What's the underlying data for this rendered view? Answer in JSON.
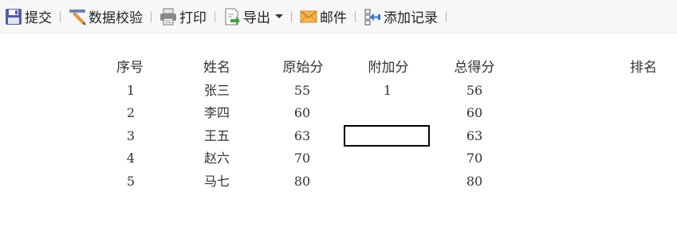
{
  "toolbar": {
    "items": [
      {
        "label": "提交",
        "icon": "save-icon"
      },
      {
        "label": "数据校验",
        "icon": "pencil-ruler-icon"
      },
      {
        "label": "打印",
        "icon": "printer-icon"
      },
      {
        "label": "导出",
        "icon": "export-icon"
      },
      {
        "label": "邮件",
        "icon": "envelope-icon"
      },
      {
        "label": "添加记录",
        "icon": "add-record-icon"
      }
    ]
  },
  "table": {
    "headers": [
      "序号",
      "姓名",
      "原始分",
      "附加分",
      "总得分",
      "排名"
    ],
    "rows": [
      [
        "1",
        "张三",
        "55",
        "1",
        "56",
        ""
      ],
      [
        "2",
        "李四",
        "60",
        "",
        "60",
        ""
      ],
      [
        "3",
        "王五",
        "63",
        "",
        "63",
        ""
      ],
      [
        "4",
        "赵六",
        "70",
        "",
        "70",
        ""
      ],
      [
        "5",
        "马七",
        "80",
        "",
        "80",
        ""
      ]
    ]
  }
}
